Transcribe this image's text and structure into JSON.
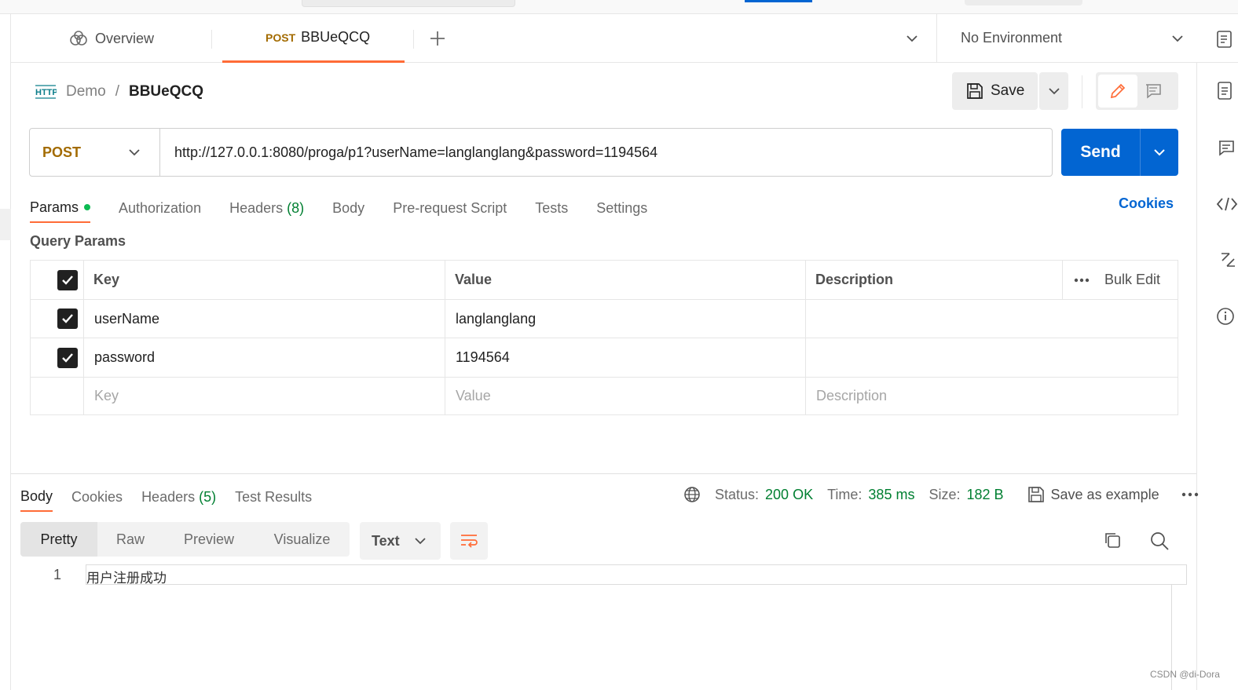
{
  "tabs": {
    "overview_label": "Overview",
    "request_method": "POST",
    "request_name": "BBUeQCQ"
  },
  "environment": {
    "selected": "No Environment"
  },
  "breadcrumb": {
    "collection": "Demo",
    "separator": "/",
    "request": "BBUeQCQ"
  },
  "toolbar": {
    "save_label": "Save"
  },
  "request": {
    "method": "POST",
    "url": "http://127.0.0.1:8080/proga/p1?userName=langlanglang&password=1194564",
    "send_label": "Send"
  },
  "request_tabs": {
    "params": "Params",
    "authorization": "Authorization",
    "headers": "Headers",
    "headers_count": "(8)",
    "body": "Body",
    "prerequest": "Pre-request Script",
    "tests": "Tests",
    "settings": "Settings",
    "cookies": "Cookies"
  },
  "query_params": {
    "title": "Query Params",
    "headers": {
      "key": "Key",
      "value": "Value",
      "description": "Description",
      "bulk_edit": "Bulk Edit"
    },
    "rows": [
      {
        "checked": true,
        "key": "userName",
        "value": "langlanglang",
        "description": ""
      },
      {
        "checked": true,
        "key": "password",
        "value": "1194564",
        "description": ""
      }
    ],
    "placeholder": {
      "key": "Key",
      "value": "Value",
      "description": "Description"
    }
  },
  "response": {
    "tabs": {
      "body": "Body",
      "cookies": "Cookies",
      "headers": "Headers",
      "headers_count": "(5)",
      "test_results": "Test Results"
    },
    "status_label": "Status:",
    "status_value": "200 OK",
    "time_label": "Time:",
    "time_value": "385 ms",
    "size_label": "Size:",
    "size_value": "182 B",
    "save_example": "Save as example",
    "views": {
      "pretty": "Pretty",
      "raw": "Raw",
      "preview": "Preview",
      "visualize": "Visualize"
    },
    "format": "Text",
    "lines": [
      {
        "number": "1",
        "text": "用户注册成功"
      }
    ]
  },
  "watermark": "CSDN @di-Dora",
  "colors": {
    "accent": "#ff6c37",
    "send": "#0265d2",
    "status_ok": "#007f31",
    "method": "#a36b00"
  }
}
